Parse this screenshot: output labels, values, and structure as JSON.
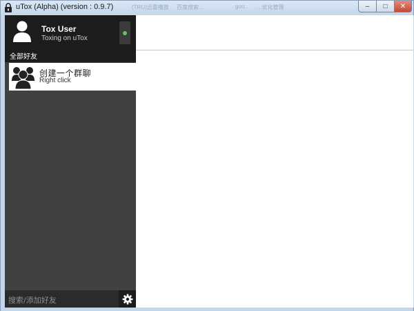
{
  "window": {
    "title": "uTox (Alpha) (version : 0.9.7)",
    "ghost_tabs": [
      "(TRU)迅雷播放",
      "百度搜索...",
      "goo..",
      "...优化管理"
    ],
    "controls": {
      "minimize": "–",
      "maximize": "□",
      "close": "✕"
    }
  },
  "self": {
    "name": "Tox User",
    "status_message": "Toxing on uTox",
    "status_color": "#6bc260",
    "avatar_icon": "user-icon"
  },
  "sidebar": {
    "filter_label": "全部好友",
    "items": [
      {
        "name": "创建一个群聊",
        "subtitle": "Right click",
        "icon": "group-icon"
      }
    ]
  },
  "search": {
    "placeholder": "搜索/添加好友"
  },
  "settings": {
    "icon": "gear-icon"
  },
  "colors": {
    "sidebar_bg": "#414141",
    "panel_dark": "#1c1c1c",
    "online": "#6bc260"
  }
}
